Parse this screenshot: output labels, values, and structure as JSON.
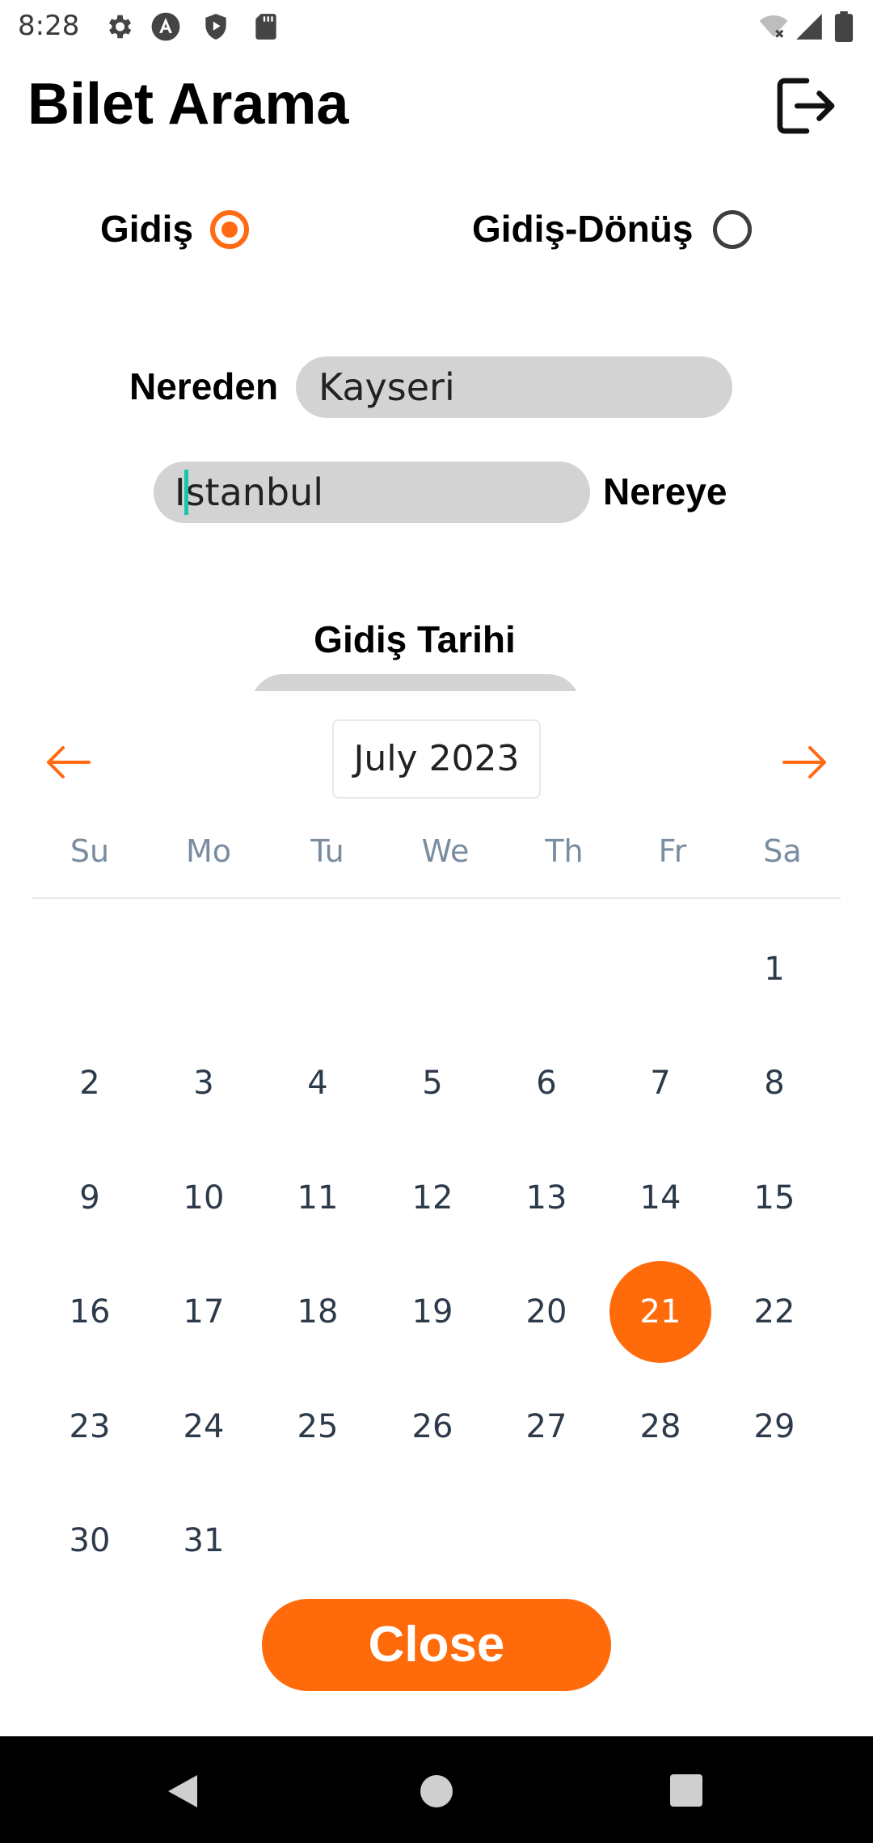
{
  "status_bar": {
    "time": "8:28",
    "icons": [
      "settings-icon",
      "angular-icon",
      "shield-play-icon",
      "sd-card-icon",
      "wifi-off-icon",
      "signal-icon",
      "battery-icon"
    ]
  },
  "header": {
    "title": "Bilet Arama",
    "logout_icon": "logout-icon"
  },
  "trip_type": {
    "one_way_label": "Gidiş",
    "round_trip_label": "Gidiş-Dönüş",
    "selected": "Gidiş"
  },
  "route": {
    "from_label": "Nereden",
    "from_value": "Kayseri",
    "to_label": "Nereye",
    "to_value": "Istanbul"
  },
  "date": {
    "label": "Gidiş Tarihi"
  },
  "calendar": {
    "month_title": "July 2023",
    "weekdays": [
      "Su",
      "Mo",
      "Tu",
      "We",
      "Th",
      "Fr",
      "Sa"
    ],
    "first_weekday_index": 6,
    "days_in_month": 31,
    "selected_day": 21,
    "accent_color": "#ff6a0a",
    "prev_icon": "arrow-left-icon",
    "next_icon": "arrow-right-icon"
  },
  "close_button": {
    "label": "Close"
  },
  "nav_bar": {
    "back_icon": "back-triangle-icon",
    "home_icon": "home-circle-icon",
    "recents_icon": "recents-square-icon"
  }
}
